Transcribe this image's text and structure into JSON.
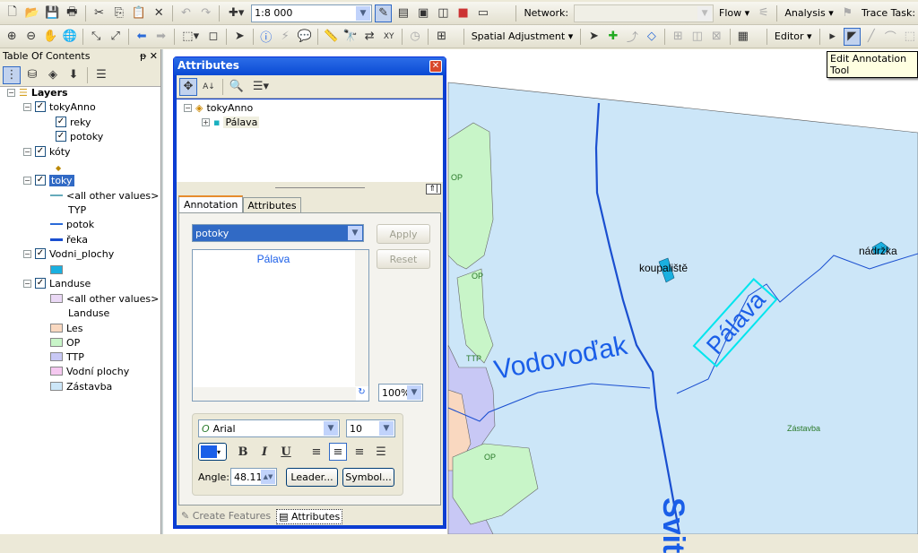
{
  "toolbar1": {
    "scale": "1:8 000",
    "network_label": "Network:",
    "network_value": "",
    "flow": "Flow ▾",
    "analysis": "Analysis ▾",
    "trace_task": "Trace Task:"
  },
  "toolbar2": {
    "spatial_adjustment": "Spatial Adjustment ▾",
    "editor": "Editor ▾"
  },
  "tooltip": "Edit Annotation Tool",
  "toc": {
    "title": "Table Of Contents",
    "pin": "ᵽ",
    "close": "✕",
    "items": [
      {
        "label": "Layers",
        "level": 0
      },
      {
        "label": "tokyAnno",
        "level": 1
      },
      {
        "label": "reky",
        "level": 2
      },
      {
        "label": "potoky",
        "level": 2
      },
      {
        "label": "kóty",
        "level": 1
      },
      {
        "label": "toky",
        "level": 1
      },
      {
        "label": "<all other values>",
        "level": 3
      },
      {
        "label": "TYP",
        "level": 3
      },
      {
        "label": "potok",
        "level": 3
      },
      {
        "label": "řeka",
        "level": 3
      },
      {
        "label": "Vodni_plochy",
        "level": 1
      },
      {
        "label": "Landuse",
        "level": 1
      },
      {
        "label": "<all other values>",
        "level": 3,
        "color": "#ead8f5"
      },
      {
        "label": "Landuse",
        "level": 3
      },
      {
        "label": "Les",
        "level": 3,
        "color": "#f9d8c0"
      },
      {
        "label": "OP",
        "level": 3,
        "color": "#c8f5c8"
      },
      {
        "label": "TTP",
        "level": 3,
        "color": "#c8c8f5"
      },
      {
        "label": "Vodní plochy",
        "level": 3,
        "color": "#f5c8f0"
      },
      {
        "label": "Zástavba",
        "level": 3,
        "color": "#cce6f8"
      }
    ]
  },
  "dialog": {
    "title": "Attributes",
    "tree_root": "tokyAnno",
    "tree_child": "Pálava",
    "tabs": [
      "Annotation",
      "Attributes"
    ],
    "class_value": "potoky",
    "text_value": "Pálava",
    "apply": "Apply",
    "reset": "Reset",
    "zoom": "100%",
    "font": "Arial",
    "size": "10",
    "bold": "B",
    "italic": "I",
    "underline": "U",
    "angle_label": "Angle:",
    "angle": "48.11",
    "leader": "Leader...",
    "symbol": "Symbol...",
    "text_color": "#1a5ee8",
    "bottom_tabs": [
      "Create Features",
      "Attributes"
    ]
  },
  "map": {
    "labels": {
      "op": "OP",
      "ttp": "TTP",
      "vodovodak": "Vodovoďak",
      "palava": "Pálava",
      "koupaliste": "koupaliště",
      "nadrzka": "nádržka",
      "zastavba": "Zástavba",
      "svit": "Svit"
    },
    "colors": {
      "water_area": "#cce6f8",
      "op": "#c8f5c8",
      "ttp": "#c8c8f5",
      "les": "#f9d8c0",
      "river": "#1a4fd0",
      "label": "#1a5ee8"
    }
  }
}
